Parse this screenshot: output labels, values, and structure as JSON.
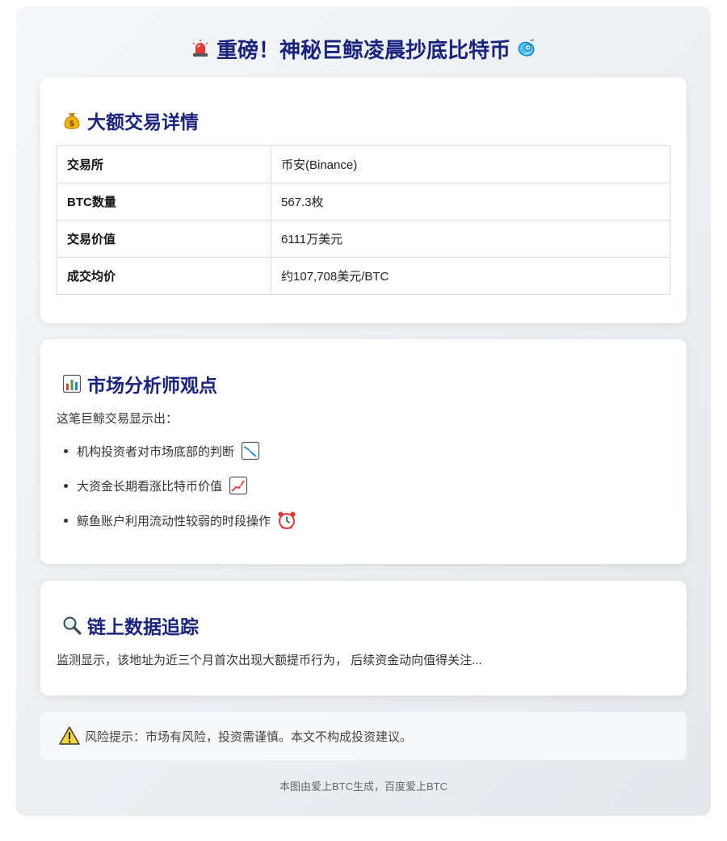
{
  "header": {
    "title": "重磅！神秘巨鲸凌晨抄底比特币",
    "left_icon": "siren-icon",
    "right_icon": "whale-icon"
  },
  "transaction": {
    "heading": "大额交易详情",
    "icon": "money-bag-icon",
    "rows": [
      {
        "key": "交易所",
        "value": "币安(Binance)"
      },
      {
        "key": "BTC数量",
        "value": "567.3枚"
      },
      {
        "key": "交易价值",
        "value": "6111万美元"
      },
      {
        "key": "成交均价",
        "value": "约107,708美元/BTC"
      }
    ]
  },
  "analysis": {
    "heading": "市场分析师观点",
    "icon": "bar-chart-icon",
    "intro": "这笔巨鲸交易显示出：",
    "points": [
      {
        "text": "机构投资者对市场底部的判断",
        "icon": "chart-down-icon"
      },
      {
        "text": "大资金长期看涨比特币价值",
        "icon": "chart-up-icon"
      },
      {
        "text": "鲸鱼账户利用流动性较弱的时段操作",
        "icon": "alarm-clock-icon"
      }
    ]
  },
  "tracking": {
    "heading": "链上数据追踪",
    "icon": "magnifier-icon",
    "body": "监测显示，该地址为近三个月首次出现大额提币行为， 后续资金动向值得关注..."
  },
  "warning": {
    "icon": "warning-icon",
    "text": "风险提示：市场有风险，投资需谨慎。本文不构成投资建议。"
  },
  "footer": {
    "text": "本图由爱上BTC生成，百度爱上BTC"
  },
  "colors": {
    "heading": "#1a237e",
    "background_start": "#f5f7fa",
    "background_end": "#e4e8ec"
  }
}
